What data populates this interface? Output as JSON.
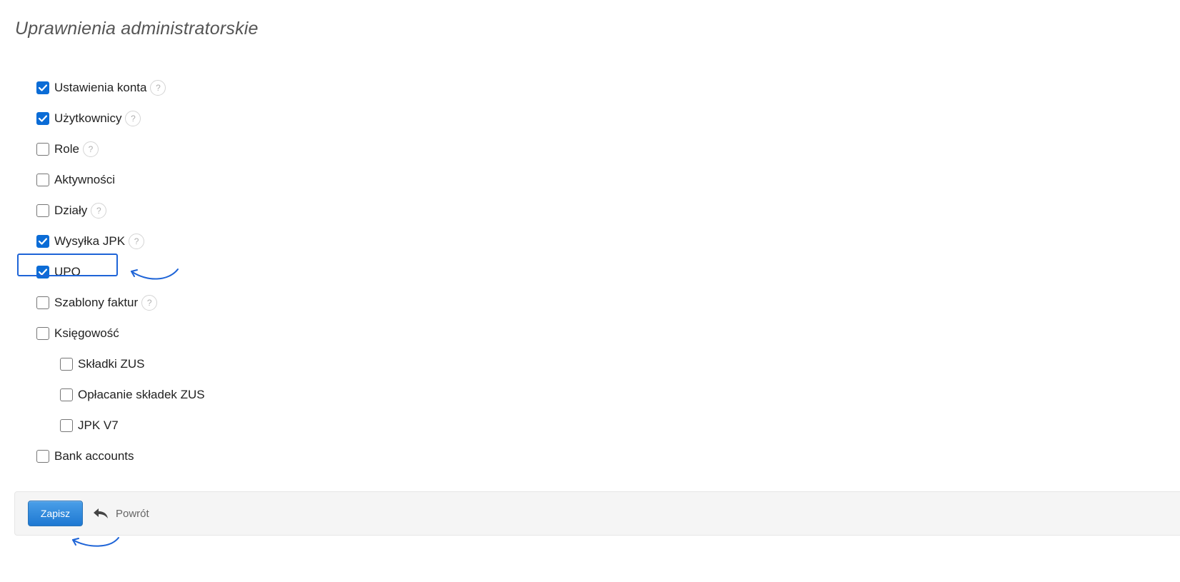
{
  "page": {
    "title": "Uprawnienia administratorskie"
  },
  "permissions": [
    {
      "label": "Ustawienia konta",
      "checked": true,
      "help": "?",
      "indent": false
    },
    {
      "label": "Użytkownicy",
      "checked": true,
      "help": "?",
      "indent": false
    },
    {
      "label": "Role",
      "checked": false,
      "help": "?",
      "indent": false
    },
    {
      "label": "Aktywności",
      "checked": false,
      "indent": false
    },
    {
      "label": "Działy",
      "checked": false,
      "help": "?",
      "indent": false
    },
    {
      "label": "Wysyłka JPK",
      "checked": true,
      "help": "?",
      "indent": false
    },
    {
      "label": "UPO",
      "checked": true,
      "indent": false
    },
    {
      "label": "Szablony faktur",
      "checked": false,
      "help": "?",
      "indent": false
    },
    {
      "label": "Księgowość",
      "checked": false,
      "indent": false
    },
    {
      "label": "Składki ZUS",
      "checked": false,
      "indent": true
    },
    {
      "label": "Opłacanie składek ZUS",
      "checked": false,
      "indent": true
    },
    {
      "label": "JPK V7",
      "checked": false,
      "indent": true
    },
    {
      "label": "Bank accounts",
      "checked": false,
      "indent": false
    }
  ],
  "actions": {
    "save_label": "Zapisz",
    "back_label": "Powrót"
  },
  "colors": {
    "accent": "#0b6cd6",
    "annotation": "#1e64d7"
  },
  "icons": {
    "back": "reply-arrow-icon",
    "help": "question-mark-icon",
    "check": "checkmark-icon"
  }
}
